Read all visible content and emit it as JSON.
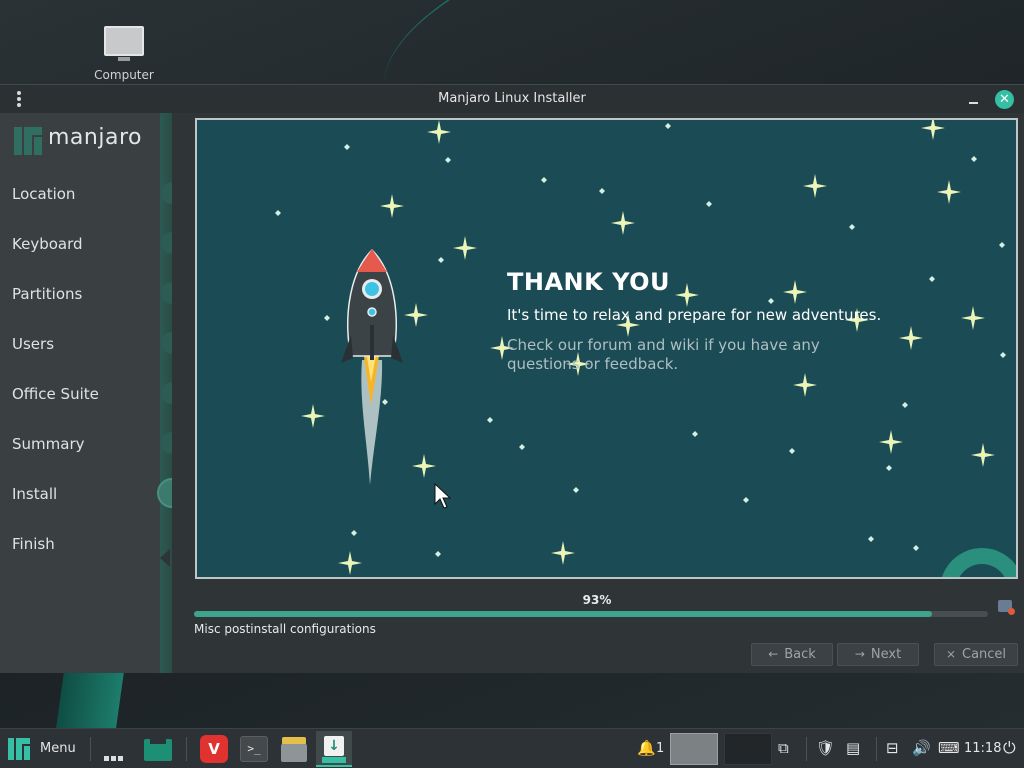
{
  "desktop": {
    "icons": [
      {
        "label": "Computer",
        "icon": "computer-icon"
      }
    ]
  },
  "window": {
    "title": "Manjaro Linux Installer",
    "close_glyph": "✕"
  },
  "sidebar": {
    "logo_text": "manjaro",
    "steps": [
      {
        "label": "Location",
        "state": "done"
      },
      {
        "label": "Keyboard",
        "state": "done"
      },
      {
        "label": "Partitions",
        "state": "done"
      },
      {
        "label": "Users",
        "state": "done"
      },
      {
        "label": "Office Suite",
        "state": "done"
      },
      {
        "label": "Summary",
        "state": "done"
      },
      {
        "label": "Install",
        "state": "current"
      },
      {
        "label": "Finish",
        "state": "pending"
      }
    ]
  },
  "slide": {
    "heading": "THANK YOU",
    "subheading": "It's time to relax and prepare for new adventures.",
    "info": "Check our forum and wiki if you have any questions or feedback."
  },
  "progress": {
    "percent_label": "93%",
    "value": 0.93,
    "status": "Misc postinstall configurations"
  },
  "buttons": {
    "back": {
      "label": "Back",
      "icon": "arrow-left-icon",
      "glyph": "←"
    },
    "next": {
      "label": "Next",
      "icon": "arrow-right-icon",
      "glyph": "→"
    },
    "cancel": {
      "label": "Cancel",
      "icon": "cancel-icon",
      "glyph": "⨯"
    }
  },
  "taskbar": {
    "menu_label": "Menu",
    "notification_count": "1",
    "clock": "11:18",
    "colors": {
      "accent": "#35bfa4",
      "panel": "#2d3236"
    }
  }
}
